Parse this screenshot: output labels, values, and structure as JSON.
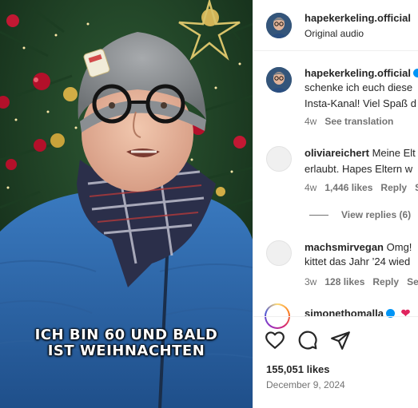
{
  "video": {
    "caption_line1": "ICH BIN 60 UND BALD",
    "caption_line2": "IST WEIHNACHTEN"
  },
  "header": {
    "username": "hapekerkeling.official",
    "audio_label": "Original audio"
  },
  "comments": [
    {
      "username": "hapekerkeling.official",
      "verified": true,
      "line1": "schenke ich euch diese",
      "line2": "Insta-Kanal! Viel Spaß d",
      "time": "4w",
      "action": "See translation"
    },
    {
      "username": "oliviareichert",
      "line1_prefix": "Meine Elt",
      "line2": "erlaubt. Hapes Eltern w",
      "time": "4w",
      "likes": "1,446 likes",
      "reply": "Reply",
      "extra": "S",
      "view_replies": "View replies (6)"
    },
    {
      "username": "machsmirvegan",
      "line1_prefix": "Omg!",
      "line2": "kittet das Jahr ’24 wied",
      "time": "3w",
      "likes": "128 likes",
      "reply": "Reply",
      "extra": "See"
    },
    {
      "username": "simonethomalla",
      "verified": true
    }
  ],
  "icons": {
    "like": "heart-icon",
    "comment": "comment-icon",
    "share": "share-icon"
  },
  "post": {
    "likes": "155,051 likes",
    "date": "December 9, 2024"
  },
  "colors": {
    "verified": "#0095f6",
    "secondary_text": "#737373",
    "divider": "#efefef"
  }
}
